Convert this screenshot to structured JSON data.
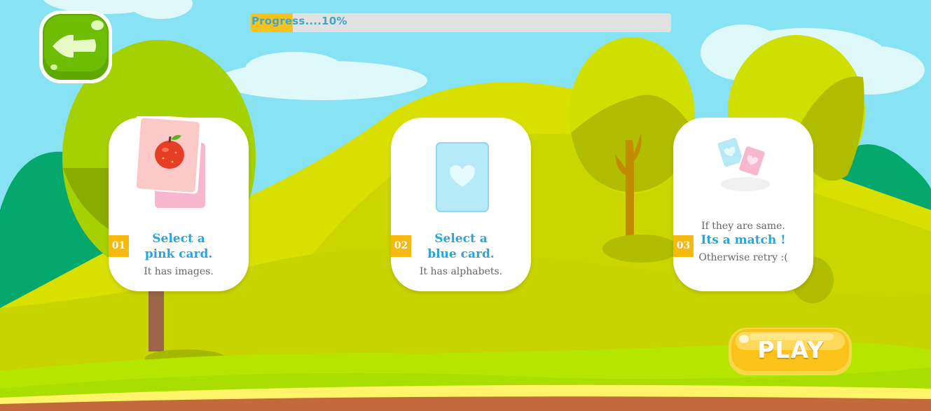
{
  "progress": {
    "label": "Progress....10%",
    "value": 0.1
  },
  "cards": [
    {
      "number": "01",
      "title_line1": "Select a",
      "title_line2": "pink card.",
      "description": "It has images."
    },
    {
      "number": "02",
      "title_line1": "Select a",
      "title_line2": "blue card.",
      "description": "It has alphabets."
    },
    {
      "number": "03",
      "line1": "If they are same.",
      "title": "Its a match !",
      "line3": "Otherwise retry :("
    }
  ],
  "play_button": {
    "label": "PLAY"
  },
  "icons": {
    "back": "arrow-left-icon",
    "card1": "apple-card-icon",
    "card2": "heart-card-icon",
    "card3": "matching-cards-icon"
  },
  "colors": {
    "sky": "#87e3f3",
    "accent_blue": "#27a6dc",
    "badge": "#f7b90e",
    "progress_fill": "#f7c21c"
  }
}
